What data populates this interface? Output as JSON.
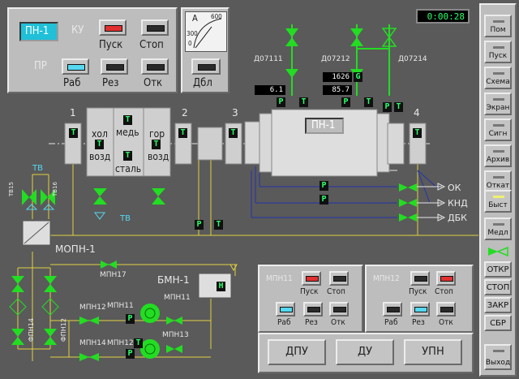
{
  "clock": "0:00:28",
  "top_panel": {
    "unit_label": "ПН-1",
    "ku_label": "КУ",
    "pr_label": "ПР",
    "pusk_label": "Пуск",
    "stop_label": "Стоп",
    "rab_label": "Раб",
    "rez_label": "Рез",
    "otk_label": "Отк"
  },
  "gauge": {
    "unit": "A",
    "max": "600",
    "mid": "300",
    "zero": "0"
  },
  "dbl_label": "Дбл",
  "sidebar": {
    "items": [
      {
        "label": "Пом"
      },
      {
        "label": "Пуск"
      },
      {
        "label": "Схема"
      },
      {
        "label": "Экран"
      },
      {
        "label": "Сигн"
      },
      {
        "label": "Архив"
      },
      {
        "label": "Откат"
      },
      {
        "label": "Быст"
      },
      {
        "label": "Медл"
      }
    ],
    "valve_buttons": [
      {
        "label": "ОТКР"
      },
      {
        "label": "СТОП"
      },
      {
        "label": "ЗАКР"
      },
      {
        "label": "СБР"
      }
    ],
    "exit_label": "Выход"
  },
  "scheme": {
    "unit_box": "ПН-1",
    "valves_top": [
      "Д07111",
      "Д07212",
      "Д07214"
    ],
    "val1": "6.1",
    "val2": "1626",
    "val2_tag": "G",
    "val3": "85.7",
    "nums": [
      "1",
      "2",
      "3",
      "4"
    ],
    "t_box": "Т",
    "p_box": "Р",
    "n_box": "Н",
    "hol": "хол",
    "vozd": "возд",
    "med": "медь",
    "stal": "сталь",
    "gor": "гор",
    "tv": "ТВ",
    "tv_bottom": "ТВ",
    "tv15": "ТВ15",
    "tv16": "ТВ16",
    "mopn": "МОПН-1",
    "bmn": "БМН-1",
    "mpn17": "МПН17",
    "mpn11": "МПН11",
    "mpn12": "МПН12",
    "mpn13": "МПН13",
    "mpn14": "МПН14",
    "mpn12b": "МПН12",
    "fpn14": "ФПН14",
    "fpn12": "ФПН12",
    "ok": "ОК",
    "knd": "КНД",
    "dbk": "ДБК"
  },
  "mpn_panels": [
    {
      "title": "МПН11",
      "pusk": "Пуск",
      "stop": "Стоп",
      "rab": "Раб",
      "rez": "Рез",
      "otk": "Отк"
    },
    {
      "title": "МПН12",
      "pusk": "Пуск",
      "stop": "Стоп",
      "rab": "Раб",
      "rez": "Рез",
      "otk": "Отк"
    }
  ],
  "bottom_buttons": [
    {
      "label": "ДПУ"
    },
    {
      "label": "ДУ"
    },
    {
      "label": "УПН"
    }
  ],
  "colors": {
    "accent_cyan": "#3fe0f0",
    "lamp_red": "#e03030",
    "lamp_yellow": "#f0f070",
    "lamp_cyan": "#55d8f0",
    "pipe_yellow": "#e0d040",
    "pipe_blue": "#2233aa",
    "valve_green": "#22dd22"
  }
}
